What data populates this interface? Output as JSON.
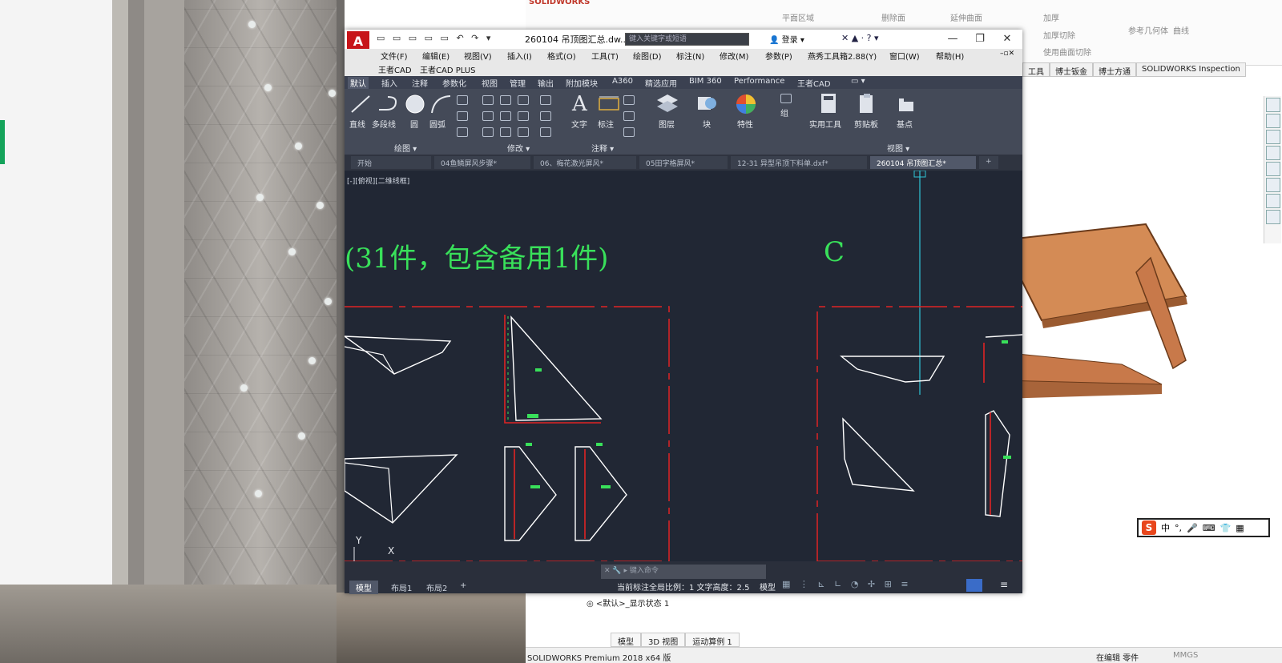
{
  "cad_window": {
    "logo": "A",
    "title": "260104 吊顶图汇总.dw...",
    "search_placeholder": "键入关键字或短语",
    "login": "登录",
    "window_buttons": {
      "minimize": "—",
      "restore": "❐",
      "close": "✕"
    },
    "menu_row1": [
      "文件(F)",
      "编辑(E)",
      "视图(V)",
      "插入(I)",
      "格式(O)",
      "工具(T)",
      "绘图(D)",
      "标注(N)",
      "修改(M)",
      "参数(P)",
      "燕秀工具箱2.88(Y)",
      "窗口(W)",
      "帮助(H)"
    ],
    "menu_row2": [
      "王者CAD",
      "王者CAD PLUS"
    ],
    "ribbon_tabs": [
      "默认",
      "插入",
      "注释",
      "参数化",
      "视图",
      "管理",
      "输出",
      "附加模块",
      "A360",
      "精选应用",
      "BIM 360",
      "Performance",
      "王者CAD"
    ],
    "ribbon_active_tab": "默认",
    "ribbon_tools": {
      "line": "直线",
      "polyline": "多段线",
      "circle": "圆",
      "arc": "圆弧",
      "text": "文字",
      "dimension": "标注",
      "layers": "图层",
      "block": "块",
      "properties": "特性",
      "group": "组",
      "utilities": "实用工具",
      "clipboard": "剪贴板",
      "base": "基点"
    },
    "ribbon_groups": [
      "绘图 ▾",
      "修改 ▾",
      "注释 ▾",
      "视图 ▾"
    ],
    "doc_tabs": [
      "开始",
      "04鱼鳞屏风步骤*",
      "06、梅花激光屏风*",
      "05田字格屏风*",
      "12-31 异型吊顶下料单.dxf*",
      "260104 吊顶图汇总*"
    ],
    "doc_active_tab": "260104 吊顶图汇总*",
    "view_label": "[-][俯视][二维线框]",
    "canvas_heading": "(31件，包含备用1件)",
    "canvas_label_c": "C",
    "ucs_y": "Y",
    "ucs_x": "X",
    "command_placeholder": "键入命令",
    "layout_tabs": [
      "模型",
      "布局1",
      "布局2"
    ],
    "layout_active": "模型",
    "status_text": "当前标注全局比例：1 文字高度：2.5",
    "status_model": "模型"
  },
  "solidworks": {
    "ribbon_items": [
      "平面区域",
      "删除面",
      "延伸曲面",
      "加厚",
      "加厚切除",
      "使用曲面切除",
      "参考几何体",
      "曲线"
    ],
    "tabs": [
      "工具",
      "博士钣金",
      "博士方通",
      "SOLIDWORKS Inspection"
    ],
    "display_state": "<默认>_显示状态 1",
    "bottom_tabs": [
      "模型",
      "3D 视图",
      "运动算例 1"
    ],
    "status_left": "SOLIDWORKS Premium 2018 x64 版",
    "status_right": "在编辑 零件",
    "status_units": "MMGS",
    "brand": "SOLIDWORKS"
  },
  "ime": {
    "logo": "S",
    "lang": "中"
  },
  "colors": {
    "cad_bg": "#212734",
    "cad_green": "#39e05a",
    "cad_red": "#e02424",
    "cad_white": "#ffffff",
    "cad_cyan": "#2fc4d6",
    "sw_wood": "#c8794a"
  }
}
